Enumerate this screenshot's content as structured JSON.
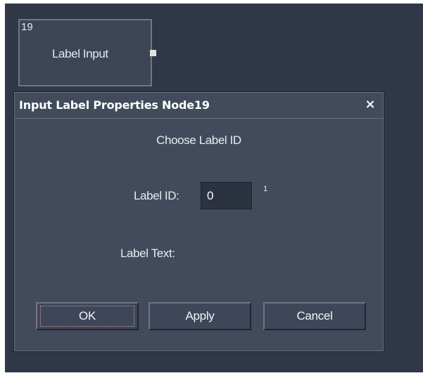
{
  "node": {
    "id": "19",
    "label": "Label Input"
  },
  "dialog": {
    "title": "Input Label Properties Node19",
    "close_symbol": "×",
    "heading": "Choose Label ID",
    "label_id_label": "Label ID:",
    "label_id_value": "0",
    "label_id_superscript": "1",
    "label_text_label": "Label Text:",
    "label_text_value": ""
  },
  "buttons": {
    "ok": "OK",
    "apply": "Apply",
    "cancel": "Cancel"
  },
  "icons": {
    "close": "close-icon",
    "output_port": "output-port-icon"
  },
  "colors": {
    "canvas": "#303848",
    "dialog_bg": "#414b5b",
    "input_bg": "#2b3341",
    "text": "#e8ebf0"
  }
}
